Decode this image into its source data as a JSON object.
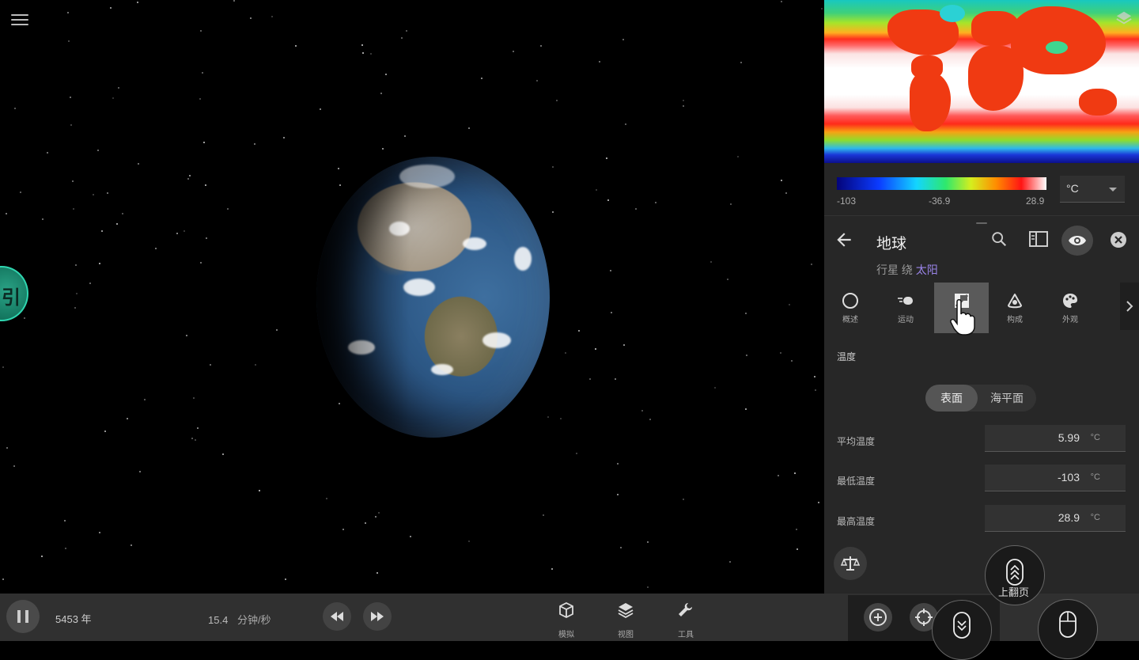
{
  "map": {
    "legend_min": "-103",
    "legend_mid": "-36.9",
    "legend_max": "28.9",
    "unit": "°C"
  },
  "body": {
    "title": "地球",
    "subtitle_prefix": "行星 绕",
    "subtitle_link": "太阳"
  },
  "tabs": [
    {
      "label": "概述",
      "icon": "circle-icon"
    },
    {
      "label": "运动",
      "icon": "motion-icon"
    },
    {
      "label": "",
      "icon": "map-icon",
      "active": true
    },
    {
      "label": "构成",
      "icon": "composition-icon"
    },
    {
      "label": "外观",
      "icon": "palette-icon"
    }
  ],
  "section": {
    "title": "温度"
  },
  "toggle": {
    "surface": "表面",
    "sea_level": "海平面",
    "selected": "surface"
  },
  "rows": [
    {
      "label": "平均温度",
      "value": "5.99",
      "unit": "°C"
    },
    {
      "label": "最低温度",
      "value": "-103",
      "unit": "°C"
    },
    {
      "label": "最高温度",
      "value": "28.9",
      "unit": "°C"
    }
  ],
  "timebar": {
    "year": "5453 年",
    "speed": "15.4",
    "speed_unit": "分钟/秒"
  },
  "tools": [
    {
      "label": "模拟",
      "icon": "cube-icon"
    },
    {
      "label": "视图",
      "icon": "layers-icon"
    },
    {
      "label": "工具",
      "icon": "wrench-icon"
    }
  ],
  "overlay": {
    "page_up": "上翻页"
  },
  "side_tab": {
    "glyph": "引"
  },
  "colors": {
    "accent_link": "#9a84e8",
    "panel_bg": "#262626",
    "side_tab": "#1b8e73"
  }
}
